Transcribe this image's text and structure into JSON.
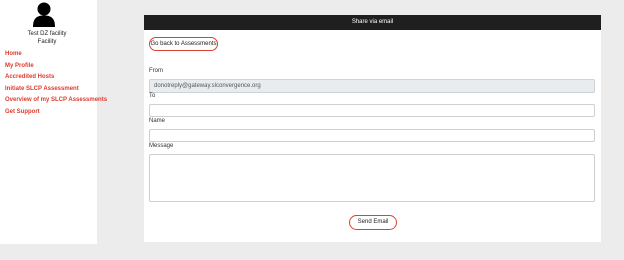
{
  "sidebar": {
    "user_name": "Test DZ facility",
    "user_role": "Facility",
    "nav": [
      {
        "label": "Home"
      },
      {
        "label": "My Profile"
      },
      {
        "label": "Accredited Hosts"
      },
      {
        "label": "Initiate SLCP Assessment"
      },
      {
        "label": "Overview of my SLCP Assessments"
      },
      {
        "label": "Get Support"
      }
    ]
  },
  "panel": {
    "title": "Share via email",
    "back_label": "Go back to Assessments",
    "from_label": "From",
    "from_value": "donotreply@gateway.slconvergence.org",
    "to_label": "To",
    "to_value": "",
    "name_label": "Name",
    "name_value": "",
    "message_label": "Message",
    "message_value": "",
    "send_label": "Send Email"
  },
  "colors": {
    "accent": "#e03a2e",
    "header_bg": "#1f1f1f",
    "page_bg": "#ececec"
  }
}
